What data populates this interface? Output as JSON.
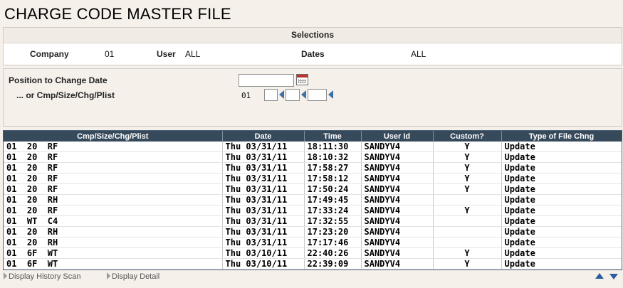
{
  "title": "CHARGE CODE MASTER FILE",
  "selections": {
    "header": "Selections",
    "company_label": "Company",
    "company_value": "01",
    "user_label": "User",
    "user_value": "ALL",
    "dates_label": "Dates",
    "dates_value": "ALL"
  },
  "position": {
    "change_date_label": "Position to Change Date",
    "change_date_value": "",
    "cmp_label": "... or Cmp/Size/Chg/Plist",
    "cmp_value": "01"
  },
  "grid": {
    "columns": [
      "Cmp/Size/Chg/Plist",
      "Date",
      "Time",
      "User Id",
      "Custom?",
      "Type of File Chng"
    ],
    "rows": [
      [
        "01  20  RF",
        "Thu 03/31/11",
        "18:11:30",
        "SANDYV4",
        "Y",
        "Update"
      ],
      [
        "01  20  RF",
        "Thu 03/31/11",
        "18:10:32",
        "SANDYV4",
        "Y",
        "Update"
      ],
      [
        "01  20  RF",
        "Thu 03/31/11",
        "17:58:27",
        "SANDYV4",
        "Y",
        "Update"
      ],
      [
        "01  20  RF",
        "Thu 03/31/11",
        "17:58:12",
        "SANDYV4",
        "Y",
        "Update"
      ],
      [
        "01  20  RF",
        "Thu 03/31/11",
        "17:50:24",
        "SANDYV4",
        "Y",
        "Update"
      ],
      [
        "01  20  RH",
        "Thu 03/31/11",
        "17:49:45",
        "SANDYV4",
        "",
        "Update"
      ],
      [
        "01  20  RF",
        "Thu 03/31/11",
        "17:33:24",
        "SANDYV4",
        "Y",
        "Update"
      ],
      [
        "01  WT  C4",
        "Thu 03/31/11",
        "17:32:55",
        "SANDYV4",
        "",
        "Update"
      ],
      [
        "01  20  RH",
        "Thu 03/31/11",
        "17:23:20",
        "SANDYV4",
        "",
        "Update"
      ],
      [
        "01  20  RH",
        "Thu 03/31/11",
        "17:17:46",
        "SANDYV4",
        "",
        "Update"
      ],
      [
        "01  6F  WT",
        "Thu 03/10/11",
        "22:40:26",
        "SANDYV4",
        "Y",
        "Update"
      ],
      [
        "01  6F  WT",
        "Thu 03/10/11",
        "22:39:09",
        "SANDYV4",
        "Y",
        "Update"
      ]
    ]
  },
  "footer": {
    "history_scan": "Display History Scan",
    "display_detail": "Display Detail",
    "page_up_icon": "triangle-up-icon",
    "page_down_icon": "triangle-down-icon"
  },
  "colors": {
    "grid_header": "#374a5c",
    "accent": "#2c5e9e"
  }
}
